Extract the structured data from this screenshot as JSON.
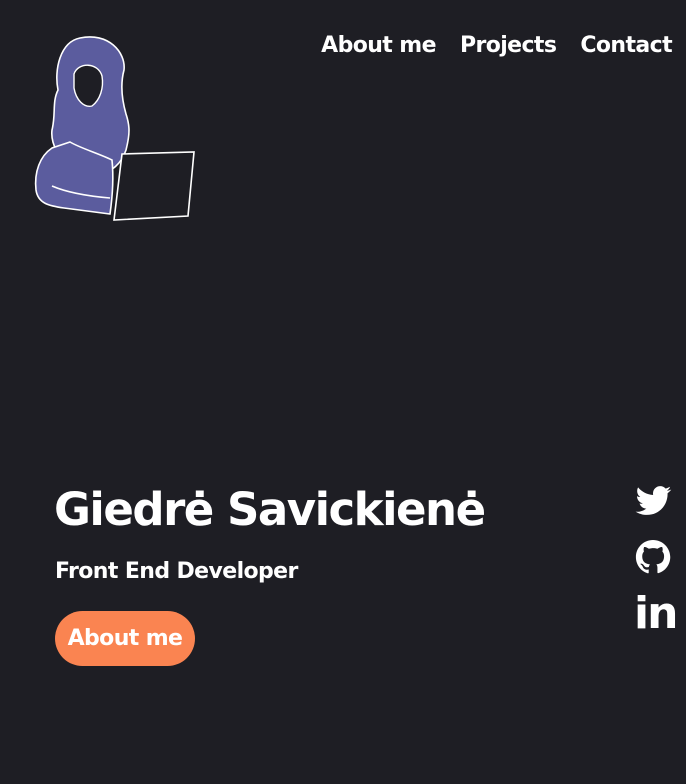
{
  "nav": {
    "items": [
      {
        "label": "About me"
      },
      {
        "label": "Projects"
      },
      {
        "label": "Contact"
      }
    ]
  },
  "hero": {
    "name": "Giedrė Savickienė",
    "role": "Front End Developer",
    "cta_label": "About me"
  },
  "social": {
    "icons": [
      "twitter-icon",
      "github-icon",
      "linkedin-icon"
    ],
    "linkedin_text": "in"
  },
  "colors": {
    "background": "#1e1e24",
    "accent": "#fa8451",
    "illustration": "#5b5c9e",
    "text": "#ffffff"
  }
}
